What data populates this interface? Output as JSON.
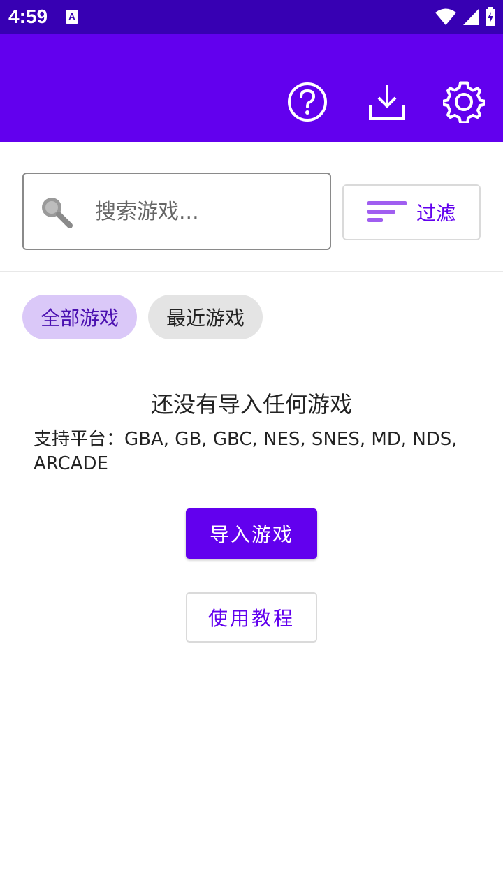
{
  "status_bar": {
    "time": "4:59",
    "icons": [
      "keyboard-a-icon",
      "wifi-icon",
      "signal-icon",
      "battery-charging-icon"
    ]
  },
  "app_bar": {
    "background": "#6200ee",
    "actions": [
      "help-icon",
      "download-icon",
      "settings-icon"
    ]
  },
  "search": {
    "placeholder": "搜索游戏...",
    "value": ""
  },
  "filter": {
    "label": "过滤"
  },
  "chips": {
    "all_games": "全部游戏",
    "recent_games": "最近游戏",
    "selected": "全部游戏"
  },
  "empty_state": {
    "title": "还没有导入任何游戏",
    "platforms": "支持平台：GBA, GB, GBC, NES, SNES, MD, NDS, ARCADE"
  },
  "buttons": {
    "import": "导入游戏",
    "tutorial": "使用教程"
  },
  "colors": {
    "primary": "#6200ee",
    "primary_dark": "#3700b3",
    "chip_selected_bg": "#dac8f8"
  }
}
